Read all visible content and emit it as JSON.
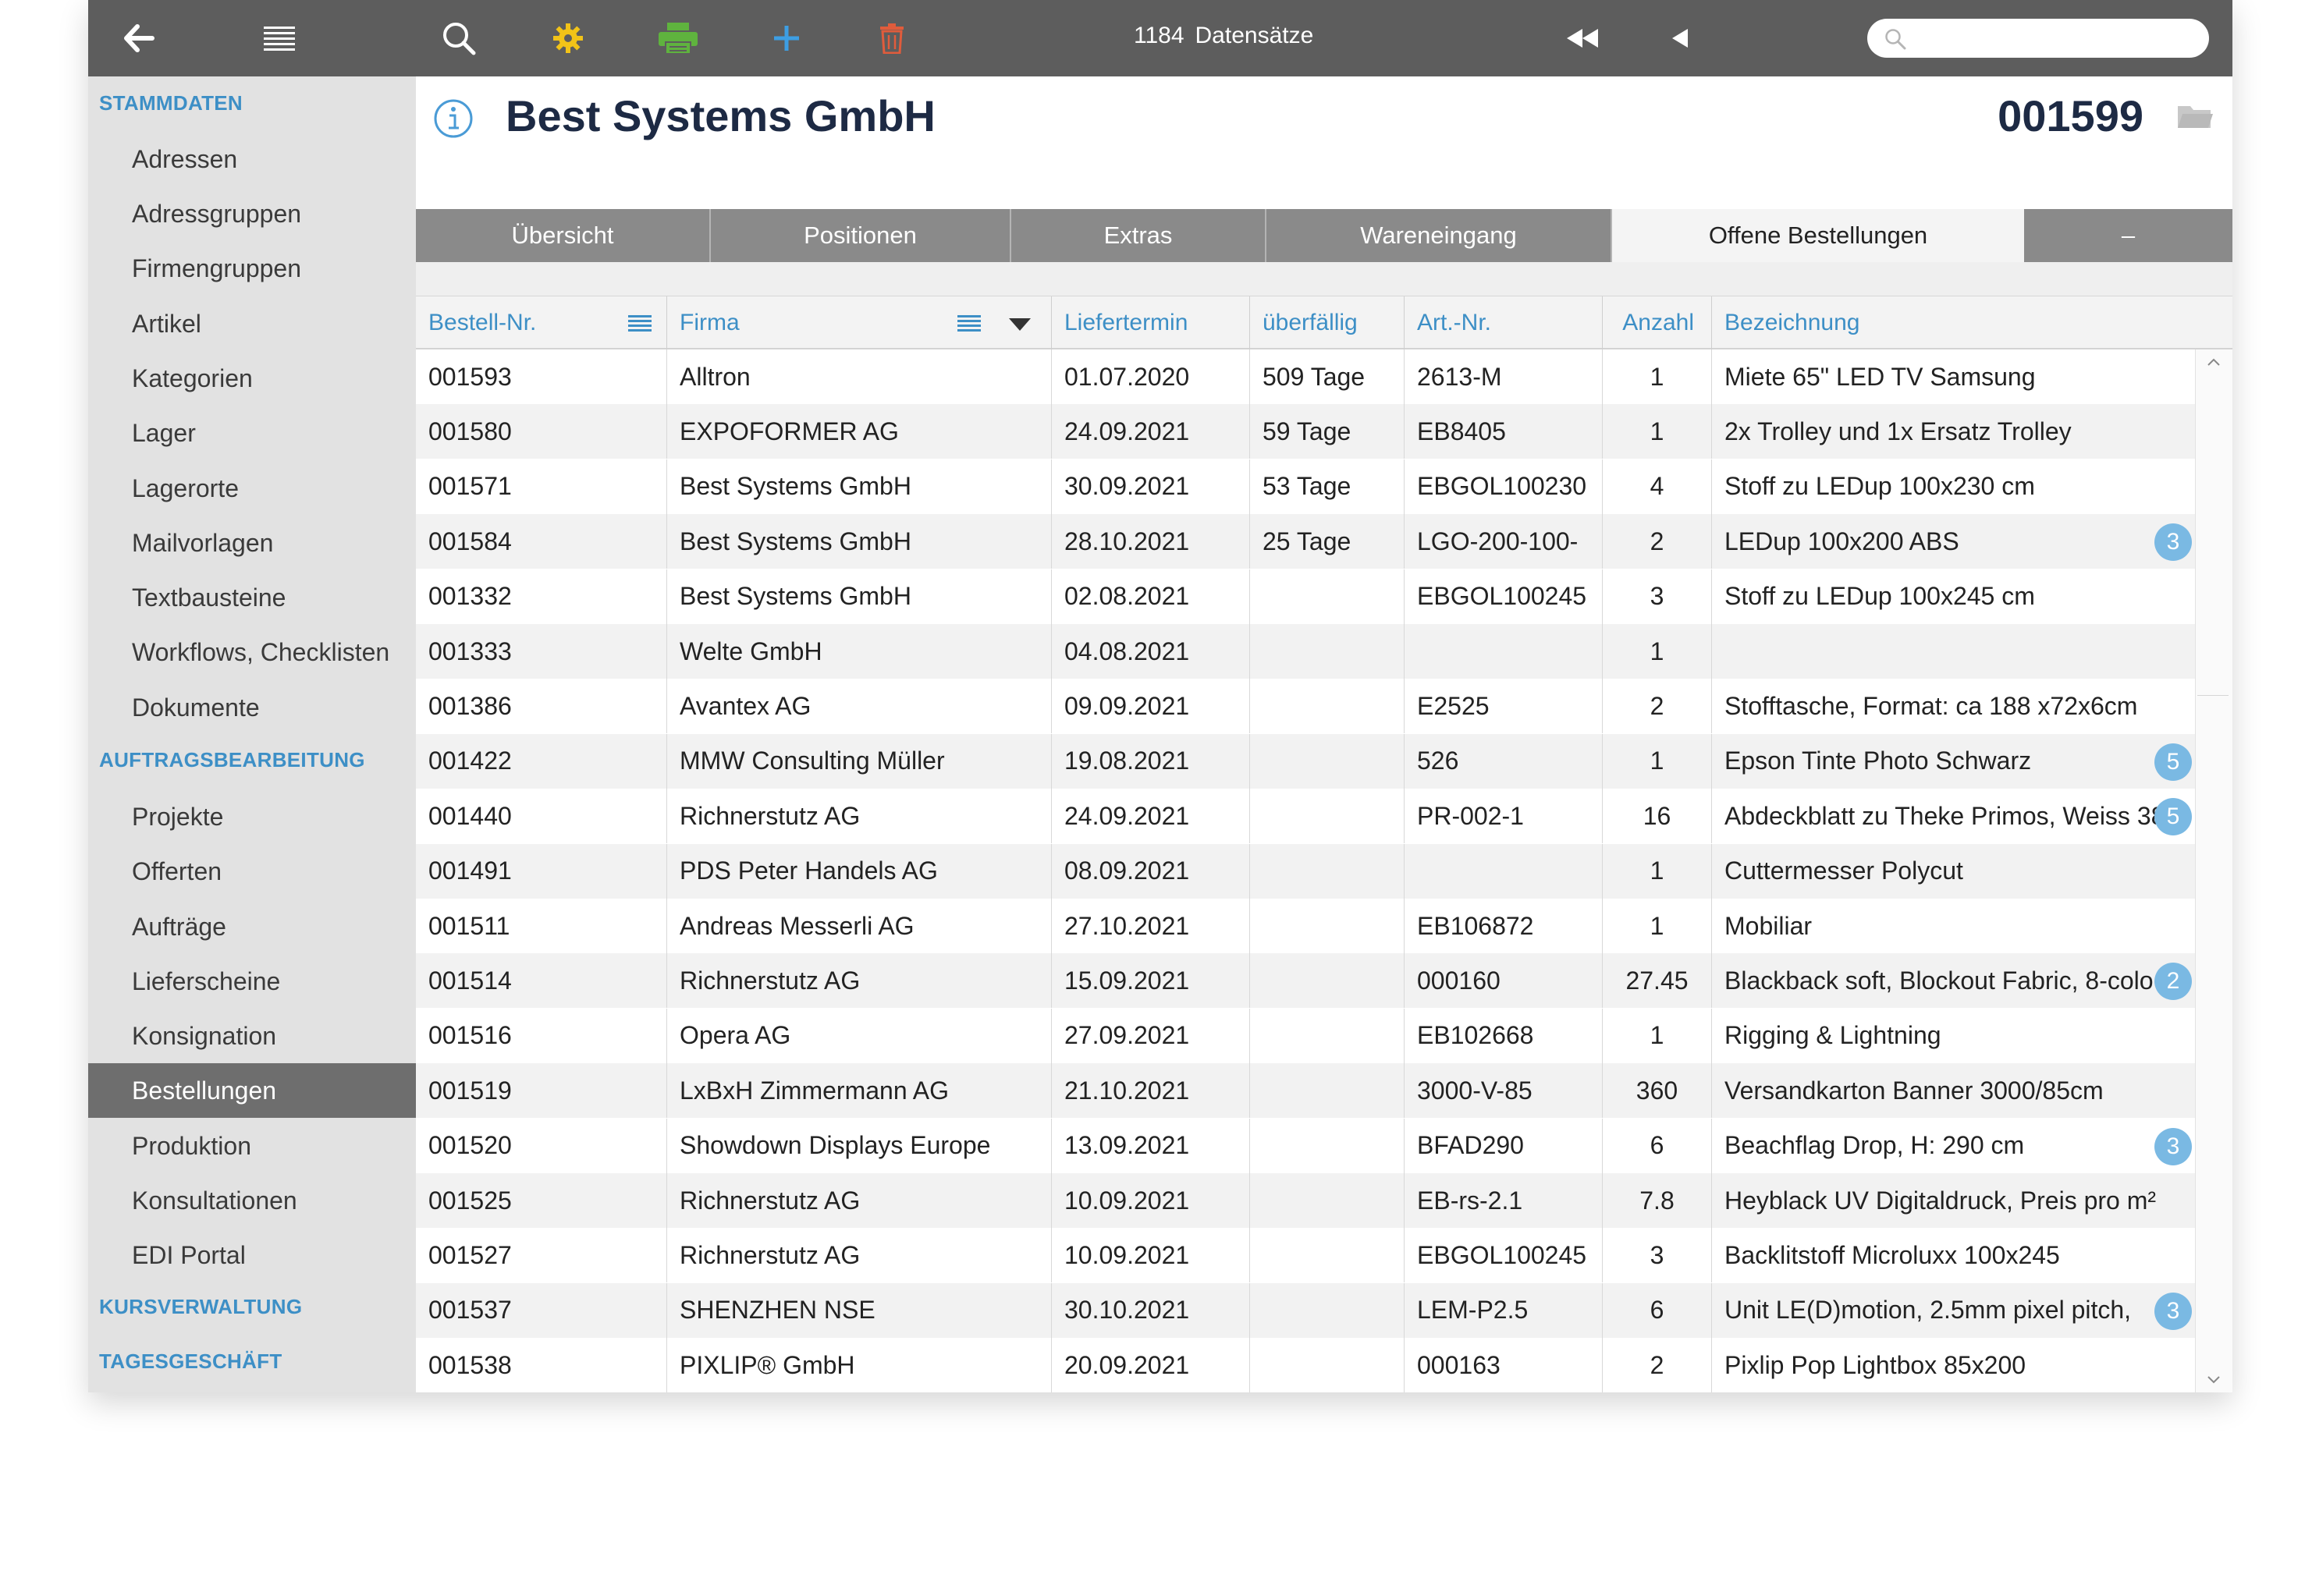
{
  "toolbar": {
    "record_count": "1184",
    "record_label": "Datensätze",
    "search_placeholder": "",
    "icons": [
      "back-arrow-icon",
      "list-menu-icon",
      "search-icon",
      "gear-icon",
      "printer-icon",
      "plus-icon",
      "trash-icon",
      "first-record-icon",
      "previous-record-icon"
    ],
    "colors": {
      "bar": "#5d5d5d",
      "gear": "#f2c318",
      "printer": "#5fb33e",
      "plus": "#3d9ee3",
      "trash": "#e05c3c"
    }
  },
  "sidebar": {
    "sections": [
      {
        "label": "STAMMDATEN",
        "items": [
          "Adressen",
          "Adressgruppen",
          "Firmengruppen",
          "Artikel",
          "Kategorien",
          "Lager",
          "Lagerorte",
          "Mailvorlagen",
          "Textbausteine",
          "Workflows, Checklisten",
          "Dokumente"
        ]
      },
      {
        "label": "AUFTRAGSBEARBEITUNG",
        "items": [
          "Projekte",
          "Offerten",
          "Aufträge",
          "Lieferscheine",
          "Konsignation",
          "Bestellungen",
          "Produktion",
          "Konsultationen",
          "EDI Portal"
        ]
      },
      {
        "label": "KURSVERWALTUNG",
        "items": []
      },
      {
        "label": "TAGESGESCHÄFT",
        "items": []
      }
    ],
    "active_item": "Bestellungen"
  },
  "header": {
    "title": "Best Systems GmbH",
    "record_number": "001599"
  },
  "tabs": [
    "Übersicht",
    "Positionen",
    "Extras",
    "Wareneingang",
    "Offene Bestellungen",
    "–"
  ],
  "active_tab": "Offene Bestellungen",
  "table": {
    "columns": [
      "Bestell-Nr.",
      "Firma",
      "Liefertermin",
      "überfällig",
      "Art.-Nr.",
      "Anzahl",
      "Bezeichnung"
    ],
    "rows": [
      {
        "nr": "001593",
        "firma": "Alltron",
        "termin": "01.07.2020",
        "ueberfaellig": "509 Tage",
        "art": "2613-M",
        "anzahl": "1",
        "bez": "Miete 65\" LED TV Samsung",
        "badge": ""
      },
      {
        "nr": "001580",
        "firma": "EXPOFORMER AG",
        "termin": "24.09.2021",
        "ueberfaellig": "59 Tage",
        "art": "EB8405",
        "anzahl": "1",
        "bez": "2x Trolley und 1x Ersatz Trolley",
        "badge": ""
      },
      {
        "nr": "001571",
        "firma": "Best Systems GmbH",
        "termin": "30.09.2021",
        "ueberfaellig": "53 Tage",
        "art": "EBGOL100230",
        "anzahl": "4",
        "bez": "Stoff zu LEDup 100x230 cm",
        "badge": ""
      },
      {
        "nr": "001584",
        "firma": "Best Systems GmbH",
        "termin": "28.10.2021",
        "ueberfaellig": "25 Tage",
        "art": "LGO-200-100-",
        "anzahl": "2",
        "bez": "LEDup 100x200 ABS",
        "badge": "3"
      },
      {
        "nr": "001332",
        "firma": "Best Systems GmbH",
        "termin": "02.08.2021",
        "ueberfaellig": "",
        "art": "EBGOL100245",
        "anzahl": "3",
        "bez": "Stoff zu LEDup 100x245 cm",
        "badge": ""
      },
      {
        "nr": "001333",
        "firma": "Welte GmbH",
        "termin": "04.08.2021",
        "ueberfaellig": "",
        "art": "",
        "anzahl": "1",
        "bez": "",
        "badge": ""
      },
      {
        "nr": "001386",
        "firma": "Avantex AG",
        "termin": "09.09.2021",
        "ueberfaellig": "",
        "art": "E2525",
        "anzahl": "2",
        "bez": "Stofftasche, Format: ca 188 x72x6cm",
        "badge": ""
      },
      {
        "nr": "001422",
        "firma": "MMW Consulting Müller",
        "termin": "19.08.2021",
        "ueberfaellig": "",
        "art": "526",
        "anzahl": "1",
        "bez": "Epson Tinte Photo Schwarz",
        "badge": "5"
      },
      {
        "nr": "001440",
        "firma": "Richnerstutz AG",
        "termin": "24.09.2021",
        "ueberfaellig": "",
        "art": "PR-002-1",
        "anzahl": "16",
        "bez": "Abdeckblatt zu Theke Primos, Weiss 38",
        "badge": "5"
      },
      {
        "nr": "001491",
        "firma": "PDS Peter Handels AG",
        "termin": "08.09.2021",
        "ueberfaellig": "",
        "art": "",
        "anzahl": "1",
        "bez": "Cuttermesser Polycut",
        "badge": ""
      },
      {
        "nr": "001511",
        "firma": "Andreas Messerli AG",
        "termin": "27.10.2021",
        "ueberfaellig": "",
        "art": "EB106872",
        "anzahl": "1",
        "bez": "Mobiliar",
        "badge": ""
      },
      {
        "nr": "001514",
        "firma": "Richnerstutz AG",
        "termin": "15.09.2021",
        "ueberfaellig": "",
        "art": "000160",
        "anzahl": "27.45",
        "bez": "Blackback soft, Blockout Fabric, 8-colo",
        "badge": "2"
      },
      {
        "nr": "001516",
        "firma": "Opera AG",
        "termin": "27.09.2021",
        "ueberfaellig": "",
        "art": "EB102668",
        "anzahl": "1",
        "bez": "Rigging & Lightning",
        "badge": ""
      },
      {
        "nr": "001519",
        "firma": "LxBxH Zimmermann AG",
        "termin": "21.10.2021",
        "ueberfaellig": "",
        "art": "3000-V-85",
        "anzahl": "360",
        "bez": "Versandkarton Banner 3000/85cm",
        "badge": ""
      },
      {
        "nr": "001520",
        "firma": "Showdown Displays Europe",
        "termin": "13.09.2021",
        "ueberfaellig": "",
        "art": "BFAD290",
        "anzahl": "6",
        "bez": "Beachflag Drop, H: 290 cm",
        "badge": "3"
      },
      {
        "nr": "001525",
        "firma": "Richnerstutz AG",
        "termin": "10.09.2021",
        "ueberfaellig": "",
        "art": "EB-rs-2.1",
        "anzahl": "7.8",
        "bez": "Heyblack UV Digitaldruck, Preis pro m²",
        "badge": ""
      },
      {
        "nr": "001527",
        "firma": "Richnerstutz AG",
        "termin": "10.09.2021",
        "ueberfaellig": "",
        "art": "EBGOL100245",
        "anzahl": "3",
        "bez": "Backlitstoff Microluxx 100x245",
        "badge": ""
      },
      {
        "nr": "001537",
        "firma": "SHENZHEN NSE",
        "termin": "30.10.2021",
        "ueberfaellig": "",
        "art": "LEM-P2.5",
        "anzahl": "6",
        "bez": "Unit LE(D)motion, 2.5mm pixel pitch,",
        "badge": "3"
      },
      {
        "nr": "001538",
        "firma": "PIXLIP® GmbH",
        "termin": "20.09.2021",
        "ueberfaellig": "",
        "art": "000163",
        "anzahl": "2",
        "bez": "Pixlip Pop Lightbox 85x200",
        "badge": ""
      }
    ]
  }
}
